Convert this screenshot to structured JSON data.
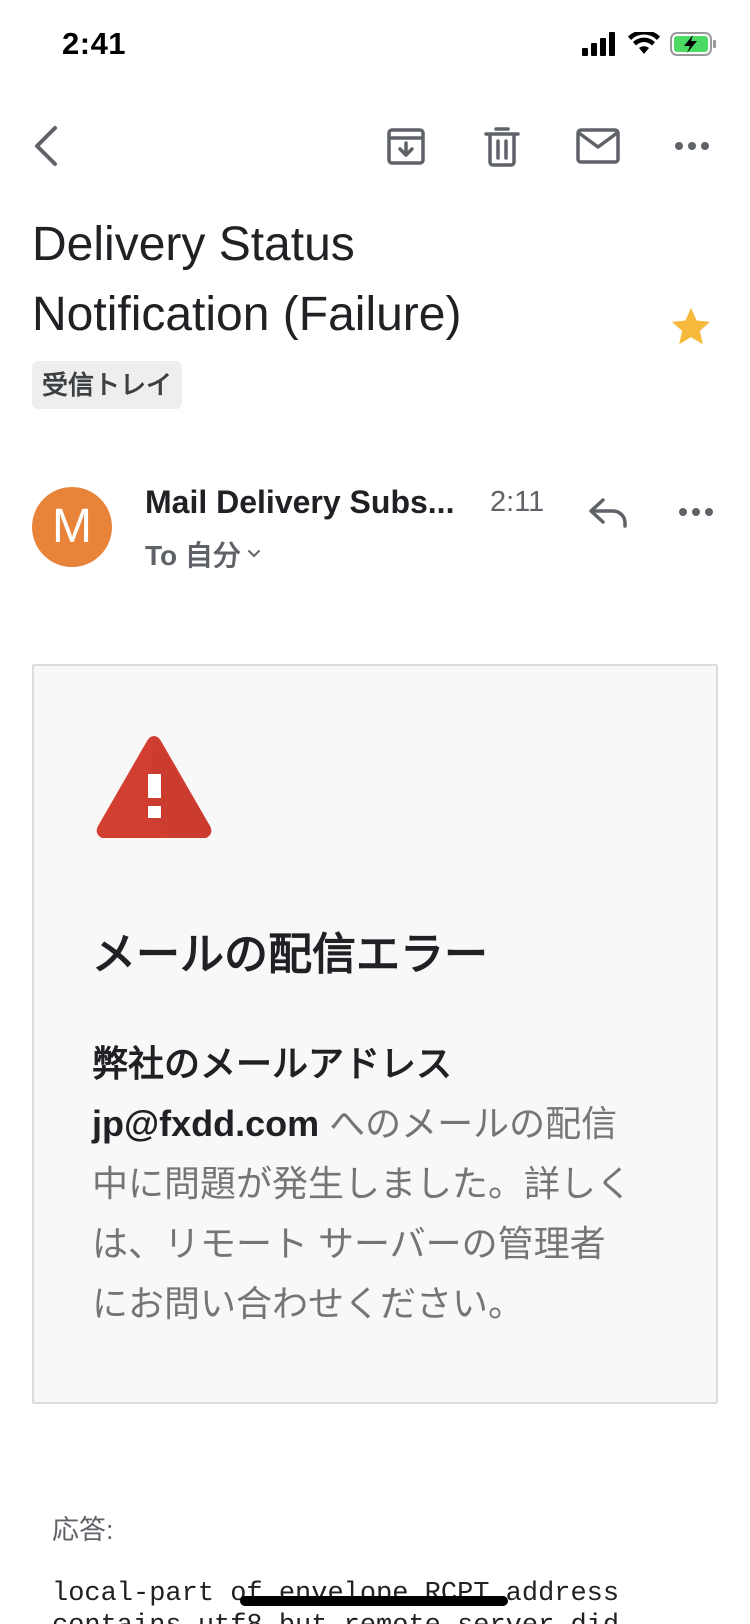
{
  "status_bar": {
    "time": "2:41",
    "icons": [
      "cellular-signal-icon",
      "wifi-icon",
      "battery-charging-icon"
    ]
  },
  "toolbar": {
    "actions": [
      "back-icon",
      "archive-icon",
      "delete-icon",
      "mark-unread-icon",
      "more-icon"
    ]
  },
  "email": {
    "subject_line1": "Delivery Status",
    "subject_line2": "Notification (Failure)",
    "starred": true,
    "label": "受信トレイ",
    "sender_initial": "M",
    "sender_name": "Mail Delivery Subs...",
    "time": "2:11",
    "recipient": "To 自分",
    "avatar_color": "#e8833a"
  },
  "card": {
    "title": "メールの配信エラー",
    "body_bold_1": "弊社のメールアドレス",
    "body_bold_2": "jp@fxdd.com",
    "body_line_1_rest": " へのメールの配信",
    "body_line_2": "中に問題が発生しました。詳しく",
    "body_line_3": "は、リモート サーバーの管理者",
    "body_line_4": "にお問い合わせください。"
  },
  "response": {
    "label": "応答:",
    "code": "local-part of envelope RCPT address\ncontains utf8 but remote server did"
  },
  "colors": {
    "star": "#f6b93b",
    "warning": "#d23f31"
  }
}
